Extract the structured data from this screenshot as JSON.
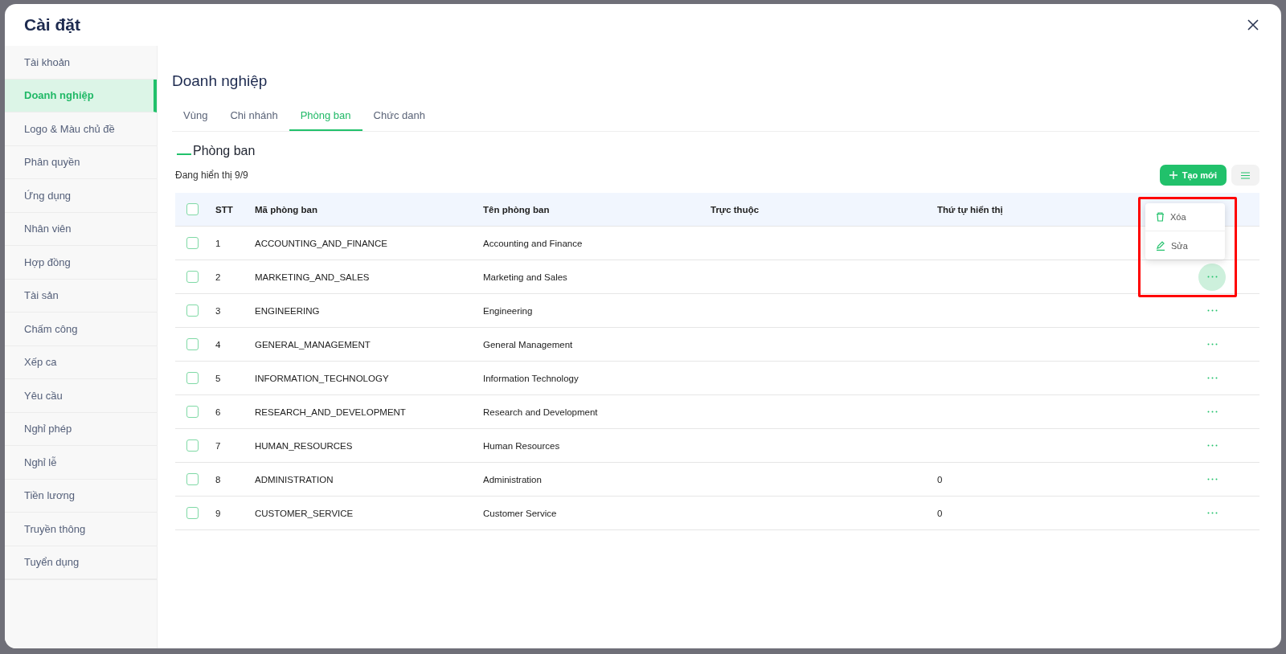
{
  "window": {
    "title": "Cài đặt"
  },
  "sidebar": {
    "items": [
      {
        "label": "Tài khoản",
        "selected": false
      },
      {
        "label": "Doanh nghiệp",
        "selected": true
      },
      {
        "label": "Logo & Màu chủ đề",
        "selected": false
      },
      {
        "label": "Phân quyền",
        "selected": false
      },
      {
        "label": "Ứng dụng",
        "selected": false
      },
      {
        "label": "Nhân viên",
        "selected": false
      },
      {
        "label": "Hợp đồng",
        "selected": false
      },
      {
        "label": "Tài sản",
        "selected": false
      },
      {
        "label": "Chấm công",
        "selected": false
      },
      {
        "label": "Xếp ca",
        "selected": false
      },
      {
        "label": "Yêu cầu",
        "selected": false
      },
      {
        "label": "Nghỉ phép",
        "selected": false
      },
      {
        "label": "Nghỉ lễ",
        "selected": false
      },
      {
        "label": "Tiền lương",
        "selected": false
      },
      {
        "label": "Truyền thông",
        "selected": false
      },
      {
        "label": "Tuyển dụng",
        "selected": false
      }
    ]
  },
  "page": {
    "title": "Doanh nghiệp",
    "tabs": [
      {
        "label": "Vùng",
        "selected": false
      },
      {
        "label": "Chi nhánh",
        "selected": false
      },
      {
        "label": "Phòng ban",
        "selected": true
      },
      {
        "label": "Chức danh",
        "selected": false
      }
    ],
    "section_title": "Phòng ban",
    "count_text": "Đang hiển thị 9/9",
    "create_button": "Tạo mới"
  },
  "table": {
    "select_all": {
      "checked": false
    },
    "columns": [
      "STT",
      "Mã phòng ban",
      "Tên phòng ban",
      "Trực thuộc",
      "Thứ tự hiển thị"
    ],
    "rows": [
      {
        "stt": "1",
        "code": "ACCOUNTING_AND_FINANCE",
        "name": "Accounting and Finance",
        "checked": false,
        "menu_open": false
      },
      {
        "stt": "2",
        "code": "MARKETING_AND_SALES",
        "name": "Marketing and Sales",
        "checked": false,
        "menu_open": true
      },
      {
        "stt": "3",
        "code": "ENGINEERING",
        "name": "Engineering",
        "checked": false,
        "menu_open": false
      },
      {
        "stt": "4",
        "code": "GENERAL_MANAGEMENT",
        "name": "General Management",
        "checked": false,
        "menu_open": false
      },
      {
        "stt": "5",
        "code": "INFORMATION_TECHNOLOGY",
        "name": "Information Technology",
        "checked": false,
        "menu_open": false
      },
      {
        "stt": "6",
        "code": "RESEARCH_AND_DEVELOPMENT",
        "name": "Research and Development",
        "checked": false,
        "menu_open": false
      },
      {
        "stt": "7",
        "code": "HUMAN_RESOURCES",
        "name": "Human Resources",
        "checked": false,
        "menu_open": false
      },
      {
        "stt": "8",
        "code": "ADMINISTRATION",
        "name": "Administration",
        "order": "0",
        "checked": false,
        "menu_open": false
      },
      {
        "stt": "9",
        "code": "CUSTOMER_SERVICE",
        "name": "Customer Service",
        "order": "0",
        "checked": false,
        "menu_open": false
      }
    ],
    "row_menu": [
      {
        "kind": "delete",
        "label": "Xóa"
      },
      {
        "kind": "edit",
        "label": "Sửa"
      }
    ]
  }
}
